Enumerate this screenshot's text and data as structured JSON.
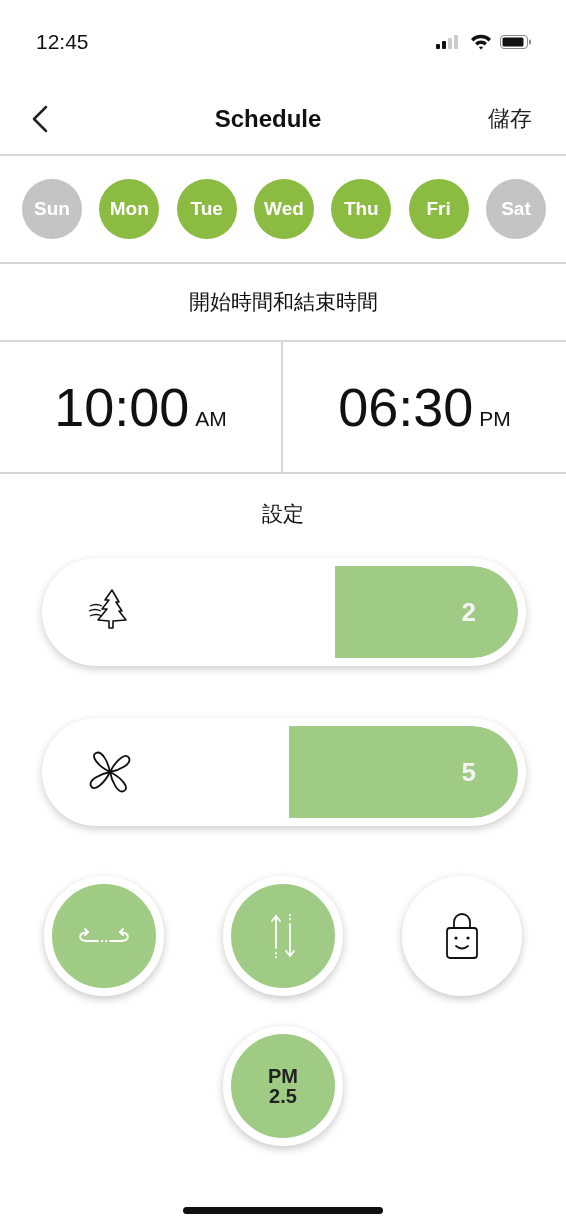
{
  "status_bar": {
    "time": "12:45"
  },
  "nav": {
    "title": "Schedule",
    "action": "儲存"
  },
  "days": [
    {
      "label": "Sun",
      "selected": false
    },
    {
      "label": "Mon",
      "selected": true
    },
    {
      "label": "Tue",
      "selected": true
    },
    {
      "label": "Wed",
      "selected": true
    },
    {
      "label": "Thu",
      "selected": true
    },
    {
      "label": "Fri",
      "selected": true
    },
    {
      "label": "Sat",
      "selected": false
    }
  ],
  "time_heading": "開始時間和結束時間",
  "times": [
    {
      "value": "10:00",
      "period": "AM"
    },
    {
      "value": "06:30",
      "period": "PM"
    }
  ],
  "settings_heading": "設定",
  "sliders": [
    {
      "kind": "tree",
      "reading": "2"
    },
    {
      "kind": "fan",
      "reading": "5"
    }
  ],
  "toggles": [
    {
      "kind": "swing",
      "on": true
    },
    {
      "kind": "airflow",
      "on": true
    },
    {
      "kind": "lock",
      "on": false
    },
    {
      "kind": "text",
      "label": "PM 2.5",
      "on": true
    }
  ]
}
